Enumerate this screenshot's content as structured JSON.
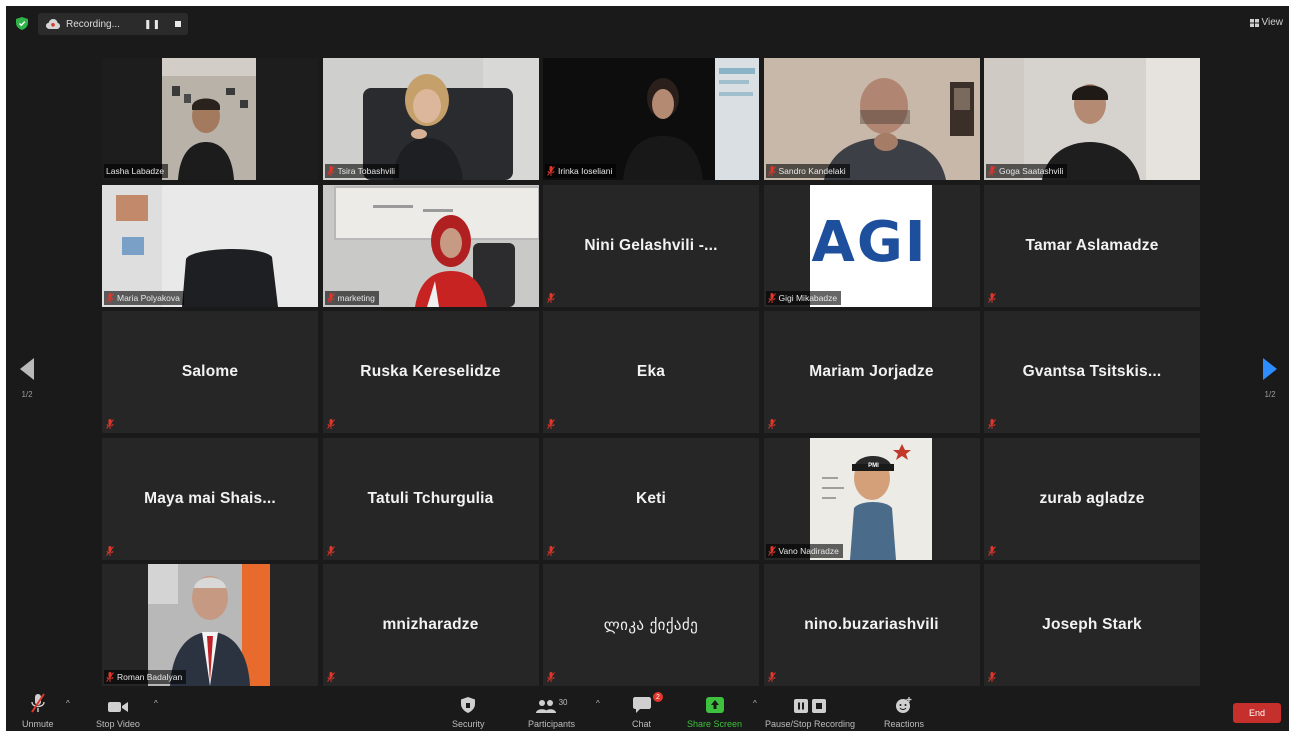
{
  "topbar": {
    "recording_label": "Recording...",
    "pause_glyph": "❚❚",
    "view_label": "View"
  },
  "participants": [
    {
      "name": "Lasha Labadze",
      "video": true,
      "active": true
    },
    {
      "name": "Tsira Tobashvili",
      "video": true
    },
    {
      "name": "Irinka Ioseliani",
      "video": true
    },
    {
      "name": "Sandro Kandelaki",
      "video": true
    },
    {
      "name": "Goga Saatashvili",
      "video": true
    },
    {
      "name": "Maria Polyakova",
      "video": true
    },
    {
      "name": "marketing",
      "video": true
    },
    {
      "name": "Nini Gelashvili -...",
      "video": false
    },
    {
      "name": "Gigi Mikabadze",
      "video": true,
      "logo_text": "AGI("
    },
    {
      "name": "Tamar Aslamadze",
      "video": false
    },
    {
      "name": "Salome",
      "video": false
    },
    {
      "name": "Ruska Kereselidze",
      "video": false
    },
    {
      "name": "Eka",
      "video": false
    },
    {
      "name": "Mariam Jorjadze",
      "video": false
    },
    {
      "name": "Gvantsa Tsitskis...",
      "video": false
    },
    {
      "name": "Maya mai Shais...",
      "video": false
    },
    {
      "name": "Tatuli Tchurgulia",
      "video": false
    },
    {
      "name": "Keti",
      "video": false
    },
    {
      "name": "Vano Nadiradze",
      "video": true,
      "badge_text": "PMI"
    },
    {
      "name": "zurab agladze",
      "video": false
    },
    {
      "name": "Roman Badalyan",
      "video": true
    },
    {
      "name": "mnizharadze",
      "video": false
    },
    {
      "name": "ლიკა ქიქაძე",
      "video": false,
      "script": "georgian"
    },
    {
      "name": "nino.buzariashvili",
      "video": false
    },
    {
      "name": "Joseph Stark",
      "video": false
    }
  ],
  "pager": {
    "left_label": "1/2",
    "right_label": "1/2"
  },
  "toolbar": {
    "unmute": "Unmute",
    "stop_video": "Stop Video",
    "security": "Security",
    "participants": "Participants",
    "participants_count": "30",
    "chat": "Chat",
    "chat_badge": "2",
    "share_screen": "Share Screen",
    "pause_stop_recording": "Pause/Stop Recording",
    "reactions": "Reactions",
    "end": "End"
  },
  "colors": {
    "background": "#1a1a1a",
    "tile": "#262626",
    "active_outline": "#c9dd62",
    "muted_red": "#e0362b",
    "share_green": "#3ec13e",
    "end_red": "#c5302c",
    "pager_arrow_right": "#2d8cff"
  },
  "icons": [
    "shield-icon",
    "cloud-icon",
    "pause-icon",
    "stop-icon",
    "grid-icon",
    "muted-mic-icon",
    "video-icon",
    "security-icon",
    "participants-icon",
    "chat-icon",
    "share-screen-icon",
    "pause-recording-icon",
    "reactions-icon",
    "arrow-left-icon",
    "arrow-right-icon"
  ]
}
